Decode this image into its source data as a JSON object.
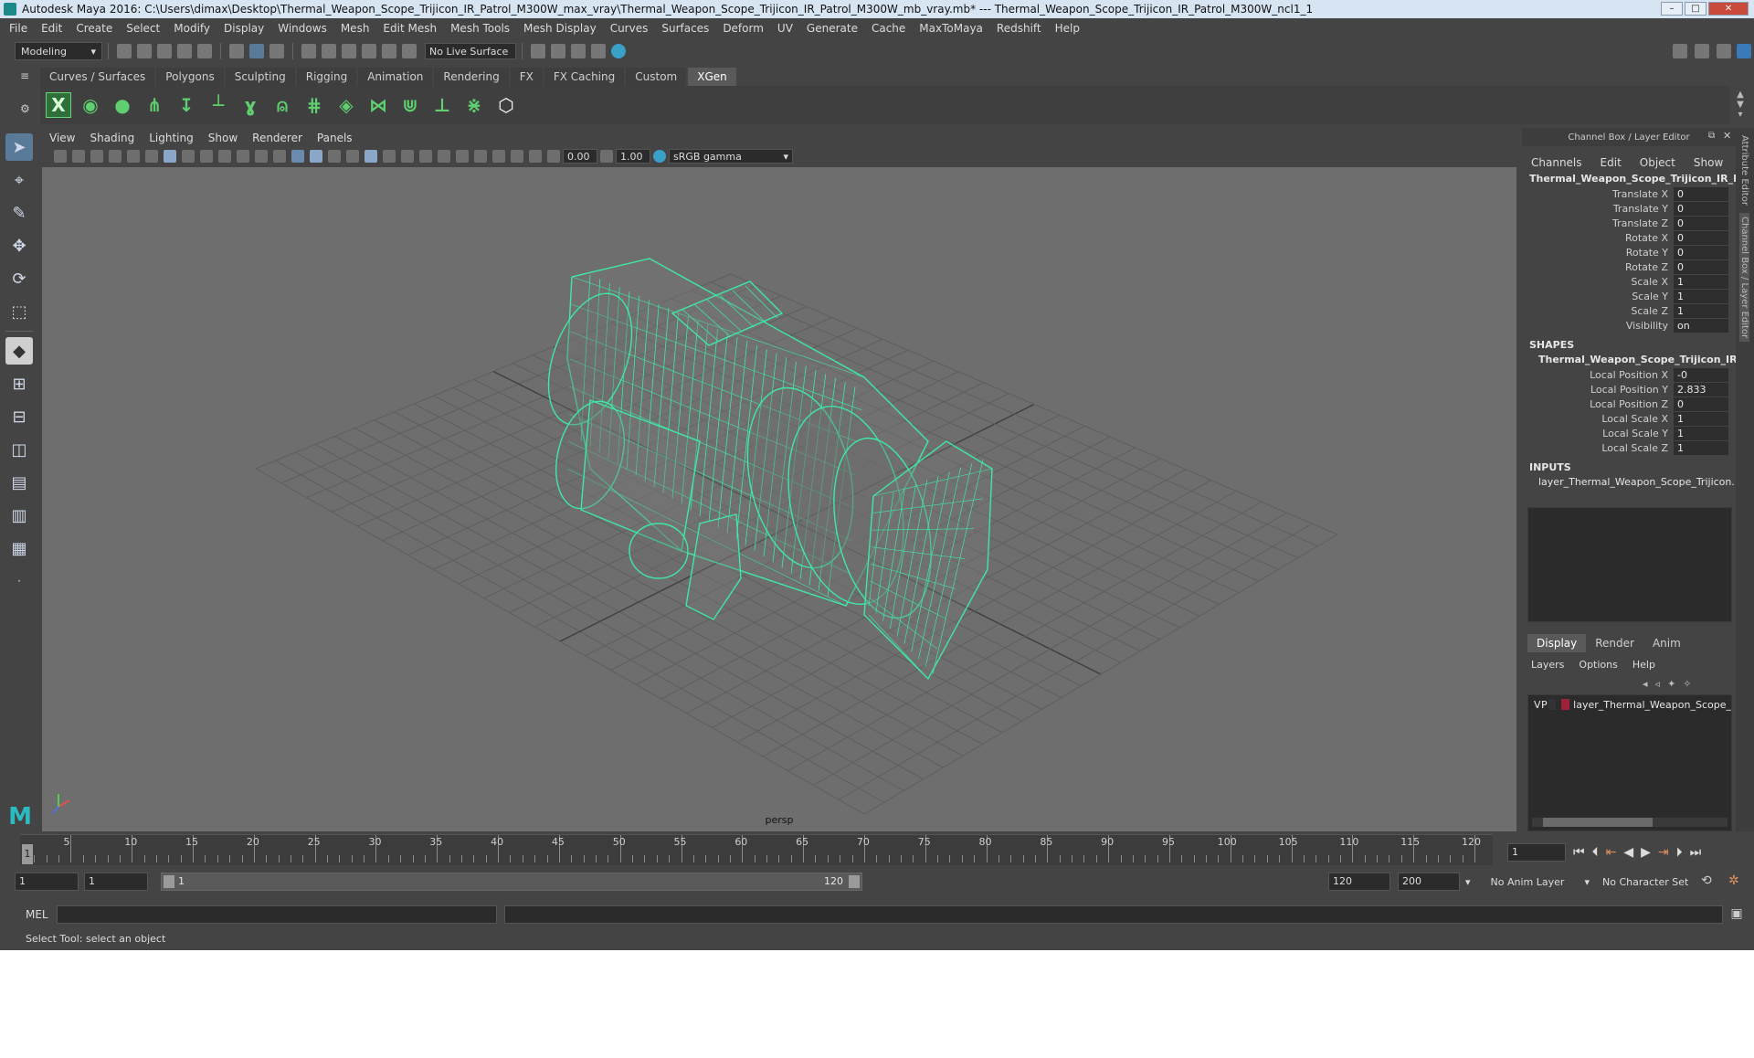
{
  "window": {
    "title": "Autodesk Maya 2016: C:\\Users\\dimax\\Desktop\\Thermal_Weapon_Scope_Trijicon_IR_Patrol_M300W_max_vray\\Thermal_Weapon_Scope_Trijicon_IR_Patrol_M300W_mb_vray.mb*   ---   Thermal_Weapon_Scope_Trijicon_IR_Patrol_M300W_ncl1_1"
  },
  "menubar": [
    "File",
    "Edit",
    "Create",
    "Select",
    "Modify",
    "Display",
    "Windows",
    "Mesh",
    "Edit Mesh",
    "Mesh Tools",
    "Mesh Display",
    "Curves",
    "Surfaces",
    "Deform",
    "UV",
    "Generate",
    "Cache",
    "MaxToMaya",
    "Redshift",
    "Help"
  ],
  "statusline": {
    "mode": "Modeling",
    "live_surface": "No Live Surface"
  },
  "shelf": {
    "tabs": [
      "Curves / Surfaces",
      "Polygons",
      "Sculpting",
      "Rigging",
      "Animation",
      "Rendering",
      "FX",
      "FX Caching",
      "Custom",
      "XGen"
    ],
    "active_tab": "XGen",
    "icons": [
      "xgen-x-icon",
      "eye-icon",
      "leaf-icon",
      "grass-add-icon",
      "grass-down-icon",
      "guide-add-icon",
      "guide-sculpt-icon",
      "guide-lock-icon",
      "guide-comb-icon",
      "layers-icon",
      "guide-cut-icon",
      "grass-multi-icon",
      "guide-len-icon",
      "guide-scatter-icon",
      "hex-icon"
    ]
  },
  "viewport": {
    "menu": [
      "View",
      "Shading",
      "Lighting",
      "Show",
      "Renderer",
      "Panels"
    ],
    "exposure": "0.00",
    "gamma": "1.00",
    "colorspace": "sRGB gamma",
    "camera_label": "persp"
  },
  "channelbox": {
    "header": "Channel Box / Layer Editor",
    "menu": [
      "Channels",
      "Edit",
      "Object",
      "Show"
    ],
    "object_name": "Thermal_Weapon_Scope_Trijicon_IR_Patr...",
    "attributes": [
      {
        "label": "Translate X",
        "value": "0"
      },
      {
        "label": "Translate Y",
        "value": "0"
      },
      {
        "label": "Translate Z",
        "value": "0"
      },
      {
        "label": "Rotate X",
        "value": "0"
      },
      {
        "label": "Rotate Y",
        "value": "0"
      },
      {
        "label": "Rotate Z",
        "value": "0"
      },
      {
        "label": "Scale X",
        "value": "1"
      },
      {
        "label": "Scale Y",
        "value": "1"
      },
      {
        "label": "Scale Z",
        "value": "1"
      },
      {
        "label": "Visibility",
        "value": "on"
      }
    ],
    "shapes_label": "SHAPES",
    "shape_name": "Thermal_Weapon_Scope_Trijicon_IR_P...",
    "shape_attributes": [
      {
        "label": "Local Position X",
        "value": "-0"
      },
      {
        "label": "Local Position Y",
        "value": "2.833"
      },
      {
        "label": "Local Position Z",
        "value": "0"
      },
      {
        "label": "Local Scale X",
        "value": "1"
      },
      {
        "label": "Local Scale Y",
        "value": "1"
      },
      {
        "label": "Local Scale Z",
        "value": "1"
      }
    ],
    "inputs_label": "INPUTS",
    "input_name": "layer_Thermal_Weapon_Scope_Trijicon..."
  },
  "layer_editor": {
    "tabs": [
      "Display",
      "Render",
      "Anim"
    ],
    "active_tab": "Display",
    "menu": [
      "Layers",
      "Options",
      "Help"
    ],
    "layers": [
      {
        "v": "V",
        "p": "P",
        "name": "layer_Thermal_Weapon_Scope_",
        "color": "#a0203a"
      }
    ]
  },
  "side_tabs": [
    "Attribute Editor",
    "Channel Box / Layer Editor"
  ],
  "timeline": {
    "ticks": [
      "5",
      "10",
      "15",
      "20",
      "25",
      "30",
      "35",
      "40",
      "45",
      "50",
      "55",
      "60",
      "65",
      "70",
      "75",
      "80",
      "85",
      "90",
      "95",
      "100",
      "105",
      "110",
      "115",
      "120"
    ],
    "current_frame": "1",
    "current_frame_field": "1"
  },
  "range": {
    "start": "1",
    "start_inner": "1",
    "slider_start": "1",
    "slider_end": "120",
    "end_inner": "120",
    "end": "200",
    "anim_layer": "No Anim Layer",
    "character_set": "No Character Set"
  },
  "command": {
    "language": "MEL",
    "help_text": "Select Tool: select an object"
  },
  "colors": {
    "wire": "#3fe8a4",
    "viewport_bg": "#6e6e6e",
    "grid": "#5e5e5e",
    "active_tab": "#5a5a5a",
    "layer_color": "#a0203a"
  }
}
